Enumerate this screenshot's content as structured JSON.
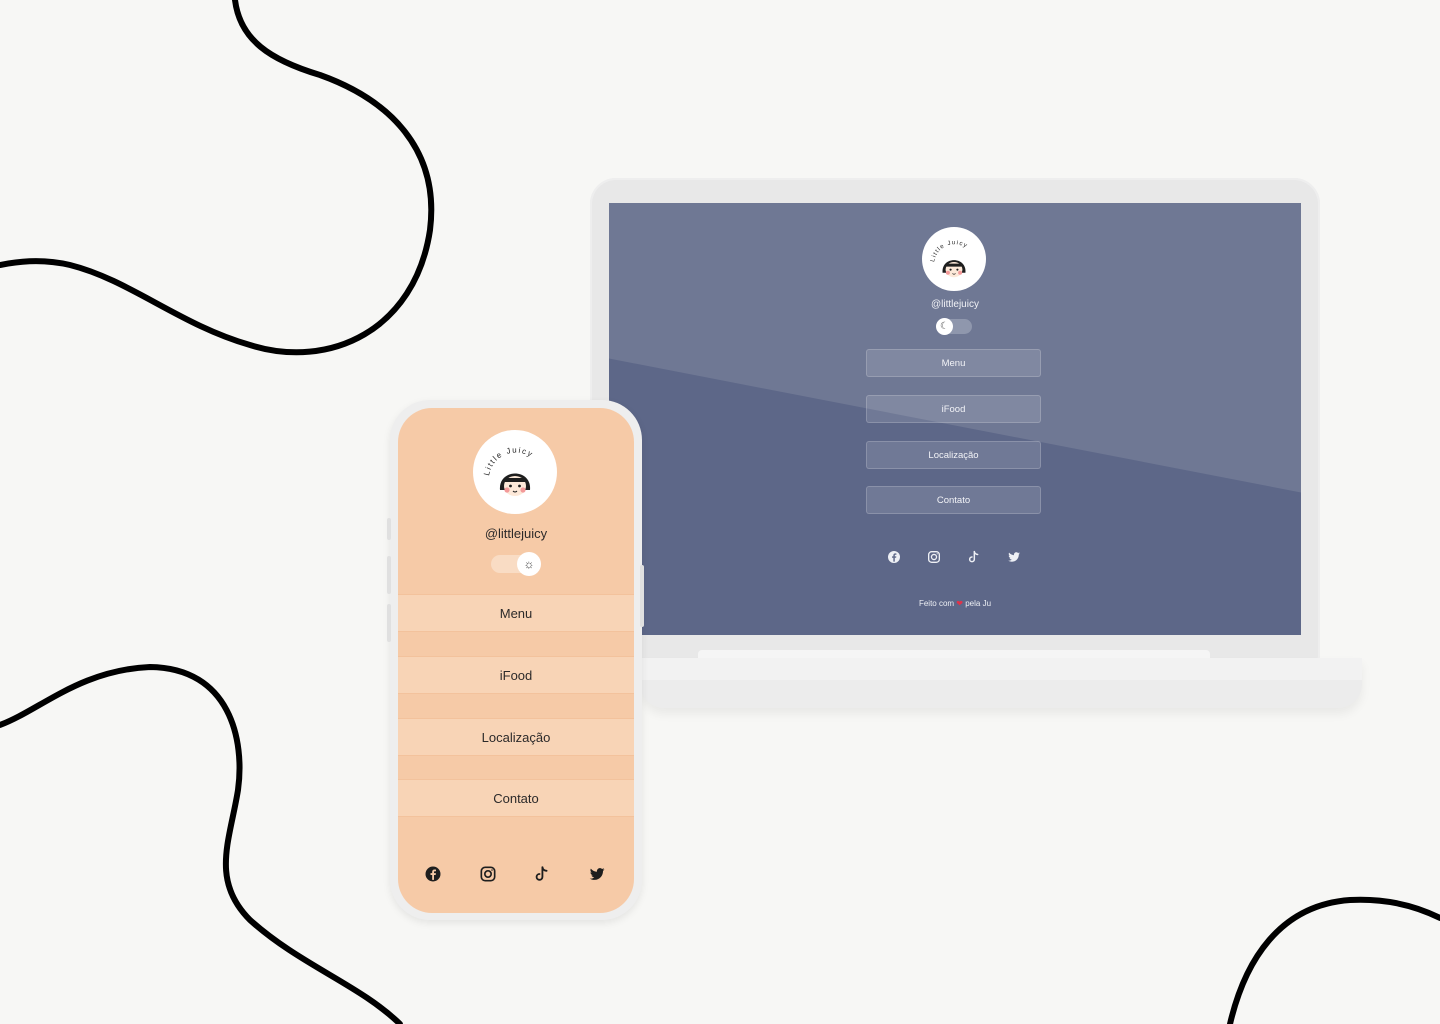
{
  "colors": {
    "background": "#f7f7f5",
    "laptop_screen": "#5d6788",
    "phone_screen": "#f6caa7",
    "heart": "#e0334a"
  },
  "profile": {
    "handle": "@littlejuicy",
    "logo_text": "Little Juicy"
  },
  "laptop": {
    "theme_toggle_icon": "moon-icon",
    "buttons": [
      "Menu",
      "iFood",
      "Localização",
      "Contato"
    ],
    "social_icons": [
      "facebook-icon",
      "instagram-icon",
      "tiktok-icon",
      "twitter-icon"
    ],
    "footer": {
      "before": "Feito com ",
      "heart": "❤",
      "after": " pela Ju"
    }
  },
  "phone": {
    "theme_toggle_icon": "sun-icon",
    "buttons": [
      "Menu",
      "iFood",
      "Localização",
      "Contato"
    ],
    "social_icons": [
      "facebook-icon",
      "instagram-icon",
      "tiktok-icon",
      "twitter-icon"
    ]
  }
}
